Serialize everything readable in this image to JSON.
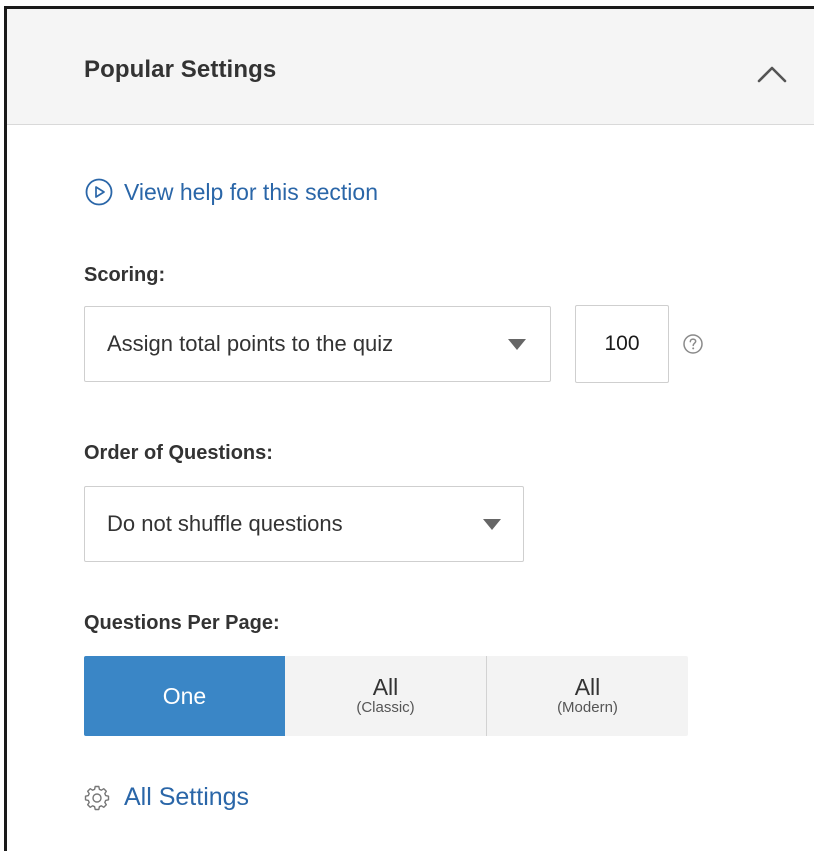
{
  "panel": {
    "title": "Popular Settings",
    "collapse_icon": "chevron-up-icon"
  },
  "help": {
    "icon": "play-circle-icon",
    "label": "View help for this section"
  },
  "scoring": {
    "label": "Scoring:",
    "selected": "Assign total points to the quiz",
    "points_value": "100",
    "help_icon": "question-circle-icon"
  },
  "order": {
    "label": "Order of Questions:",
    "selected": "Do not shuffle questions"
  },
  "per_page": {
    "label": "Questions Per Page:",
    "options": [
      {
        "main": "One",
        "sub": "",
        "active": true
      },
      {
        "main": "All",
        "sub": "(Classic)",
        "active": false
      },
      {
        "main": "All",
        "sub": "(Modern)",
        "active": false
      }
    ]
  },
  "footer": {
    "icon": "gear-icon",
    "label": "All Settings"
  },
  "colors": {
    "accent": "#3a86c6",
    "link": "#2a66a8",
    "header_bg": "#f5f5f5"
  }
}
